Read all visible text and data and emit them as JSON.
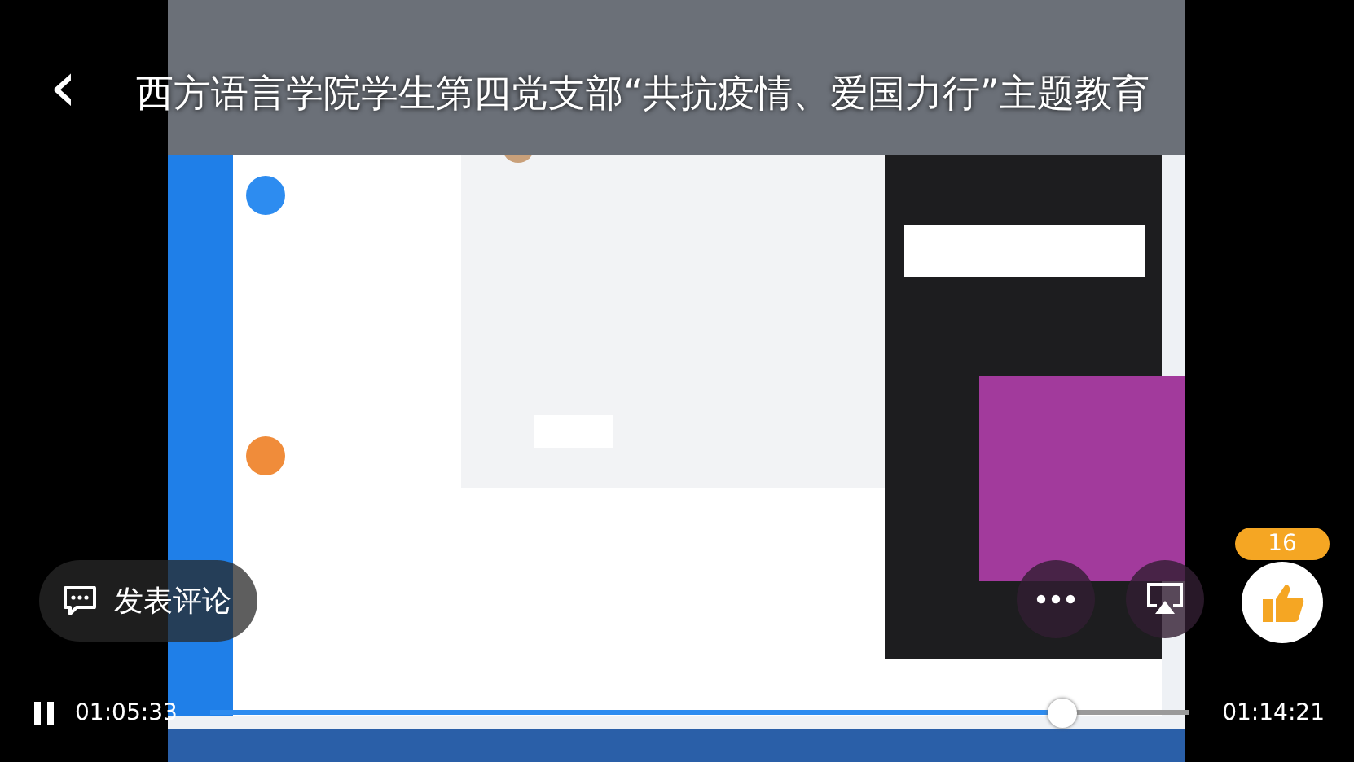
{
  "header": {
    "back_icon": "‹",
    "title": "西方语言学院学生第四党支部“共抗疫情、爱国力行”主题教育"
  },
  "comment_button": {
    "label": "发表评论"
  },
  "like": {
    "count": "16"
  },
  "player": {
    "playing": true,
    "elapsed": "01:05:33",
    "duration": "01:14:21",
    "level": 0.87
  }
}
